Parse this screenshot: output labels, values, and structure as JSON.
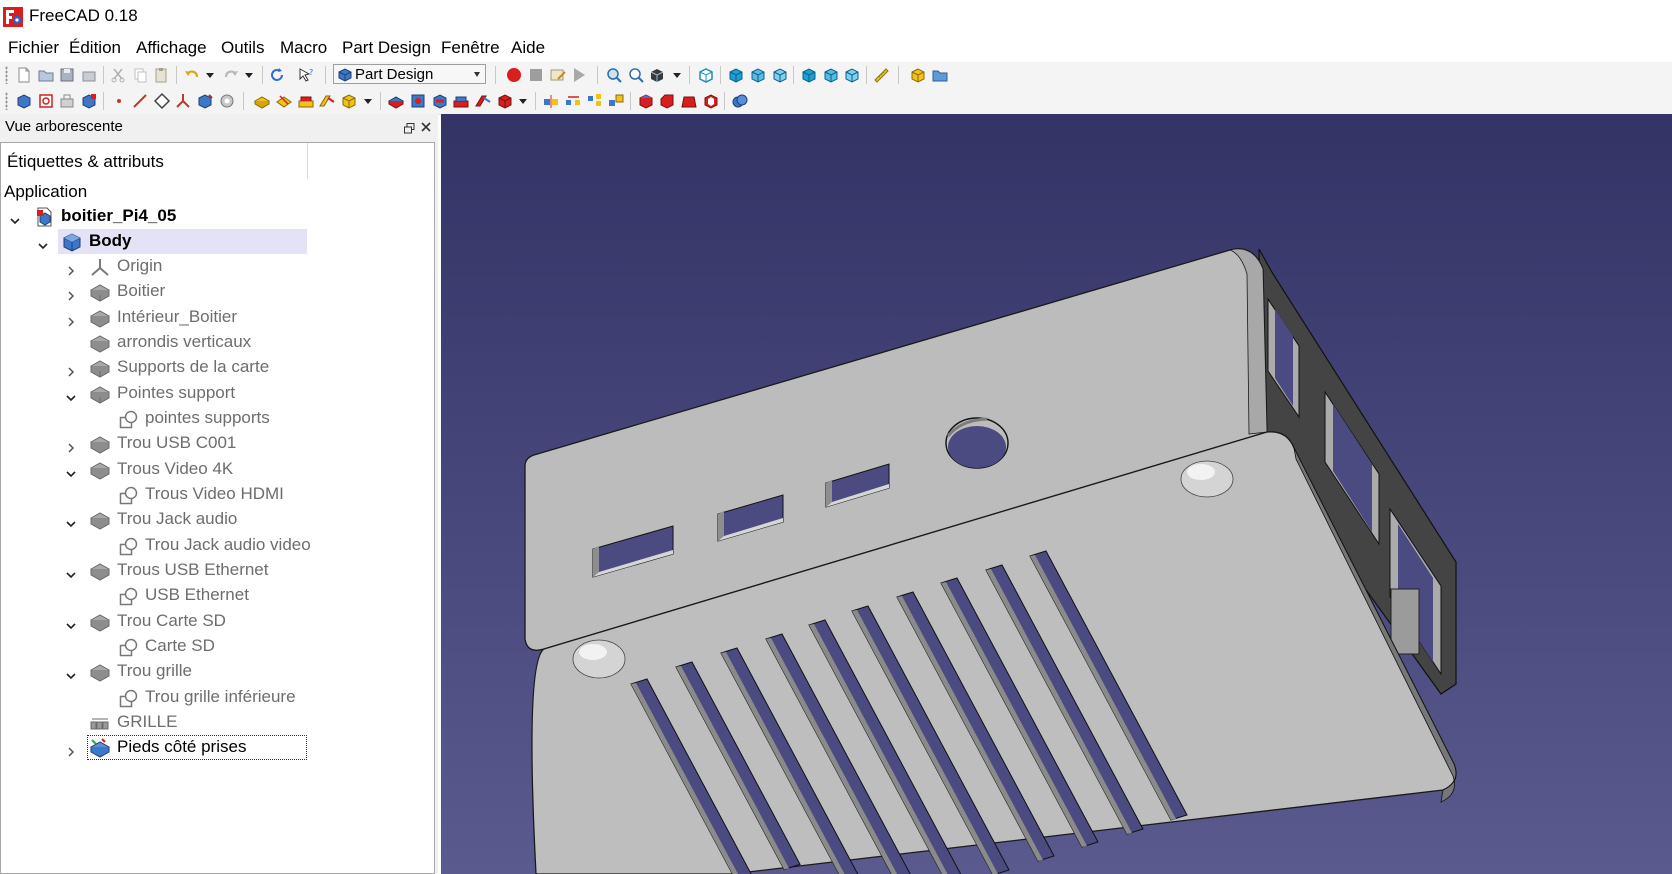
{
  "window": {
    "title": "FreeCAD 0.18"
  },
  "menu": [
    "Fichier",
    "Édition",
    "Affichage",
    "Outils",
    "Macro",
    "Part Design",
    "Fenêtre",
    "Aide"
  ],
  "toolbar": {
    "workbench": "Part Design",
    "accent_colors": {
      "record": "#d71f1f",
      "cube": "#1a9fd6",
      "yellow": "#f2c21b"
    }
  },
  "tree_panel": {
    "title": "Vue arborescente",
    "column_header": "Étiquettes & attributs",
    "section": "Application",
    "items": [
      {
        "label": "boitier_Pi4_05",
        "icon": "document-icon",
        "depth": 0,
        "expander": "expanded",
        "style": "bold"
      },
      {
        "label": "Body",
        "icon": "body-icon",
        "depth": 1,
        "expander": "expanded",
        "style": "bold-selected"
      },
      {
        "label": "Origin",
        "icon": "origin-icon",
        "depth": 2,
        "expander": "collapsed",
        "style": "gray"
      },
      {
        "label": "Boitier",
        "icon": "feature-icon",
        "depth": 2,
        "expander": "collapsed",
        "style": "gray"
      },
      {
        "label": "Intérieur_Boitier",
        "icon": "feature-icon",
        "depth": 2,
        "expander": "collapsed",
        "style": "gray"
      },
      {
        "label": "arrondis verticaux",
        "icon": "feature-icon",
        "depth": 2,
        "expander": "none",
        "style": "gray"
      },
      {
        "label": "Supports de la carte",
        "icon": "feature-icon",
        "depth": 2,
        "expander": "collapsed",
        "style": "gray"
      },
      {
        "label": "Pointes support",
        "icon": "feature-icon",
        "depth": 2,
        "expander": "expanded",
        "style": "gray"
      },
      {
        "label": "pointes supports",
        "icon": "sketch-icon",
        "depth": 3,
        "expander": "none",
        "style": "gray"
      },
      {
        "label": "Trou USB C001",
        "icon": "feature-icon",
        "depth": 2,
        "expander": "collapsed",
        "style": "gray"
      },
      {
        "label": "Trous Video 4K",
        "icon": "feature-icon",
        "depth": 2,
        "expander": "expanded",
        "style": "gray"
      },
      {
        "label": "Trous Video HDMI",
        "icon": "sketch-icon",
        "depth": 3,
        "expander": "none",
        "style": "gray"
      },
      {
        "label": "Trou Jack audio",
        "icon": "feature-icon",
        "depth": 2,
        "expander": "expanded",
        "style": "gray"
      },
      {
        "label": "Trou Jack audio video",
        "icon": "sketch-icon",
        "depth": 3,
        "expander": "none",
        "style": "gray"
      },
      {
        "label": "Trous USB Ethernet",
        "icon": "feature-icon",
        "depth": 2,
        "expander": "expanded",
        "style": "gray"
      },
      {
        "label": "USB Ethernet",
        "icon": "sketch-icon",
        "depth": 3,
        "expander": "none",
        "style": "gray"
      },
      {
        "label": "Trou Carte SD",
        "icon": "feature-icon",
        "depth": 2,
        "expander": "expanded",
        "style": "gray"
      },
      {
        "label": "Carte SD",
        "icon": "sketch-icon",
        "depth": 3,
        "expander": "none",
        "style": "gray"
      },
      {
        "label": "Trou grille",
        "icon": "feature-icon",
        "depth": 2,
        "expander": "expanded",
        "style": "gray"
      },
      {
        "label": "Trou grille inférieure",
        "icon": "sketch-icon",
        "depth": 3,
        "expander": "none",
        "style": "gray"
      },
      {
        "label": "GRILLE",
        "icon": "array-icon",
        "depth": 2,
        "expander": "none",
        "style": "gray"
      },
      {
        "label": "Pieds côté prises",
        "icon": "active-feature-icon",
        "depth": 2,
        "expander": "collapsed",
        "style": "focused"
      }
    ]
  },
  "viewport": {
    "background_top": "#333366",
    "background_bottom": "#5a5a8f",
    "model_color": "#bdbdbd"
  }
}
